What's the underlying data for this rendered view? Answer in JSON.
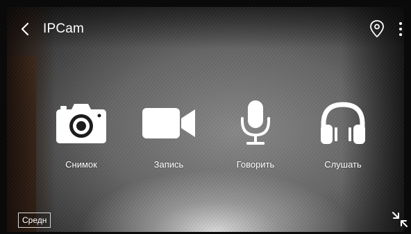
{
  "header": {
    "title": "IPCam",
    "back_icon": "chevron-left-icon",
    "location_icon": "map-pin-icon",
    "menu_icon": "more-vertical-icon"
  },
  "actions": [
    {
      "label": "Снимок",
      "icon": "camera-icon"
    },
    {
      "label": "Запись",
      "icon": "video-camera-icon"
    },
    {
      "label": "Говорить",
      "icon": "microphone-icon"
    },
    {
      "label": "Слушать",
      "icon": "headphones-icon"
    }
  ],
  "footer": {
    "quality_label": "Средн",
    "exit_fullscreen_icon": "exit-fullscreen-icon"
  },
  "colors": {
    "icon": "#ffffff",
    "text": "#ffffff",
    "badge_border": "#d8d8d8"
  }
}
